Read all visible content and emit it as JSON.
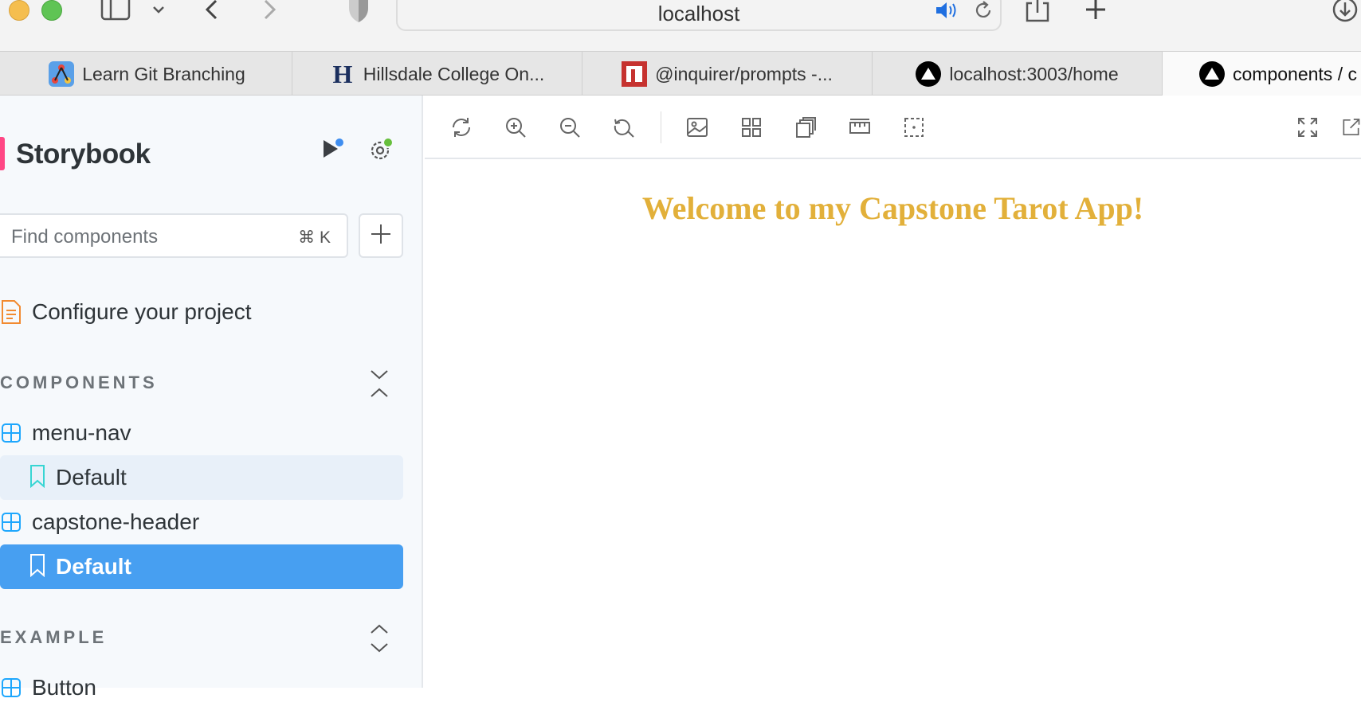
{
  "browser": {
    "url": "localhost",
    "tabs": [
      {
        "label": "Learn Git Branching",
        "icon": "git-branching-icon"
      },
      {
        "label": "Hillsdale College On...",
        "icon": "hillsdale-h-icon"
      },
      {
        "label": "@inquirer/prompts -...",
        "icon": "npm-icon"
      },
      {
        "label": "localhost:3003/home",
        "icon": "vercel-triangle-icon"
      },
      {
        "label": "components / c",
        "icon": "vercel-triangle-icon"
      }
    ]
  },
  "sidebar": {
    "brand": "Storybook",
    "search_placeholder": "Find components",
    "search_shortcut": "⌘ K",
    "configure": "Configure your project",
    "sections": [
      {
        "title": "COMPONENTS",
        "items": [
          {
            "label": "menu-nav",
            "type": "component"
          },
          {
            "label": "Default",
            "type": "story",
            "state": "hover"
          },
          {
            "label": "capstone-header",
            "type": "component"
          },
          {
            "label": "Default",
            "type": "story",
            "state": "selected"
          }
        ]
      },
      {
        "title": "EXAMPLE",
        "items": [
          {
            "label": "Button",
            "type": "component"
          }
        ]
      }
    ]
  },
  "toolbar": {
    "icons": [
      "reload-icon",
      "zoom-in-icon",
      "zoom-out-icon",
      "reset-zoom-icon",
      "background-icon",
      "grid-icon",
      "viewport-icon",
      "measure-icon",
      "outline-icon",
      "fullscreen-icon",
      "open-new-tab-icon"
    ]
  },
  "canvas": {
    "heading": "Welcome to my Capstone Tarot App!"
  },
  "colors": {
    "accent": "#479ff1",
    "brand": "#ff4785",
    "heading": "#e2b03a",
    "status_dot_blue": "#3f8ef0",
    "status_dot_green": "#66bf3c"
  }
}
